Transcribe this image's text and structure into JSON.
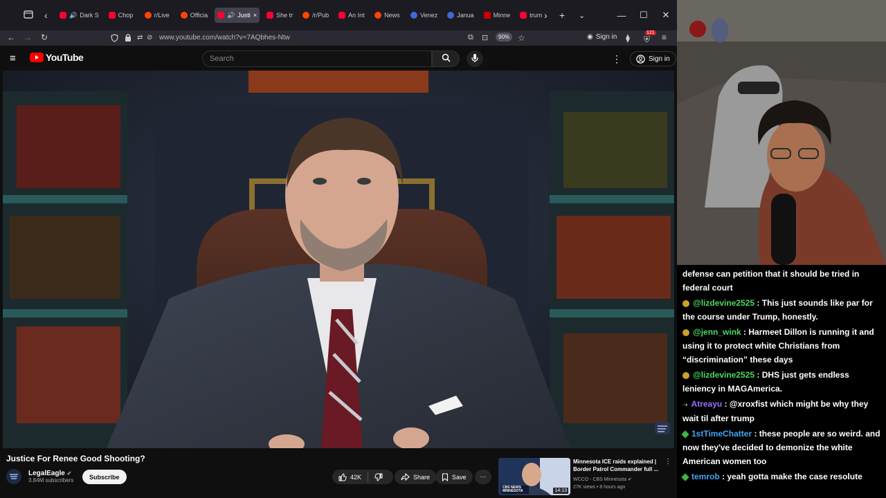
{
  "browser": {
    "tabs": [
      {
        "label": "Dark S",
        "favicon": "youtube",
        "audio": true,
        "active": false
      },
      {
        "label": "Chop",
        "favicon": "youtube",
        "audio": false,
        "active": false
      },
      {
        "label": "r/Live",
        "favicon": "reddit",
        "audio": false,
        "active": false
      },
      {
        "label": "Officia",
        "favicon": "reddit",
        "audio": false,
        "active": false
      },
      {
        "label": "Justi",
        "favicon": "youtube",
        "audio": true,
        "active": true
      },
      {
        "label": "She tr",
        "favicon": "youtube",
        "audio": false,
        "active": false
      },
      {
        "label": "/r/Pub",
        "favicon": "reddit",
        "audio": false,
        "active": false
      },
      {
        "label": "An Int",
        "favicon": "youtube",
        "audio": false,
        "active": false
      },
      {
        "label": "News",
        "favicon": "reddit",
        "audio": false,
        "active": false
      },
      {
        "label": "Venez",
        "favicon": "fl",
        "audio": false,
        "active": false
      },
      {
        "label": "Janua",
        "favicon": "fl",
        "audio": false,
        "active": false
      },
      {
        "label": "Minne",
        "favicon": "cnn",
        "audio": false,
        "active": false
      },
      {
        "label": "trum",
        "favicon": "youtube",
        "audio": false,
        "active": false
      }
    ],
    "close_tab_glyph": "×",
    "url": "www.youtube.com/watch?v=7AQbhes-Ntw",
    "zoom": "90%",
    "signin_label": "Sign in",
    "ext_badge": "121"
  },
  "youtube": {
    "logo_text": "YouTube",
    "search_placeholder": "Search",
    "signin_label": "Sign in",
    "video_title": "Justice For Renee Good Shooting?",
    "channel_name": "LegalEagle",
    "channel_subs": "3.84M subscribers",
    "subscribe_label": "Subscribe",
    "likes": "42K",
    "share_label": "Share",
    "save_label": "Save",
    "recommended": {
      "title": "Minnesota ICE raids explained | Border Patrol Commander full ...",
      "channel": "WCCO - CBS Minnesota",
      "meta": "27K views • 8 hours ago",
      "duration": "14:13",
      "thumb_label": "CBS NEWS MINNESOTA"
    }
  },
  "chat": {
    "messages": [
      {
        "badge": "",
        "user": "",
        "user_color": "#ffffff",
        "text": "defense can petition that it should be tried in federal court"
      },
      {
        "badge": "sub",
        "user": "@lizdevine2525",
        "user_color": "#4cd964",
        "text": " : This just sounds like par for the course under Trump, honestly."
      },
      {
        "badge": "sub",
        "user": "@jenn_wink",
        "user_color": "#4cd964",
        "text": " : Harmeet Dillon is running it and using it to protect white Christians from “discrimination” these days"
      },
      {
        "badge": "sub",
        "user": "@lizdevine2525",
        "user_color": "#4cd964",
        "text": " : DHS just gets endless leniency in MAGAmerica."
      },
      {
        "badge": "arrow",
        "user": "Atreayu",
        "user_color": "#9b6bff",
        "text": " : @xroxfist which might be why they wait til after trump"
      },
      {
        "badge": "gem",
        "user": "1stTimeChatter",
        "user_color": "#3fa9f5",
        "text": " : these people are so weird. and now they've decided to demonize the white American women too"
      },
      {
        "badge": "gem",
        "user": "temrob",
        "user_color": "#3fa9f5",
        "text": " : yeah gotta make the case resolute"
      }
    ]
  }
}
